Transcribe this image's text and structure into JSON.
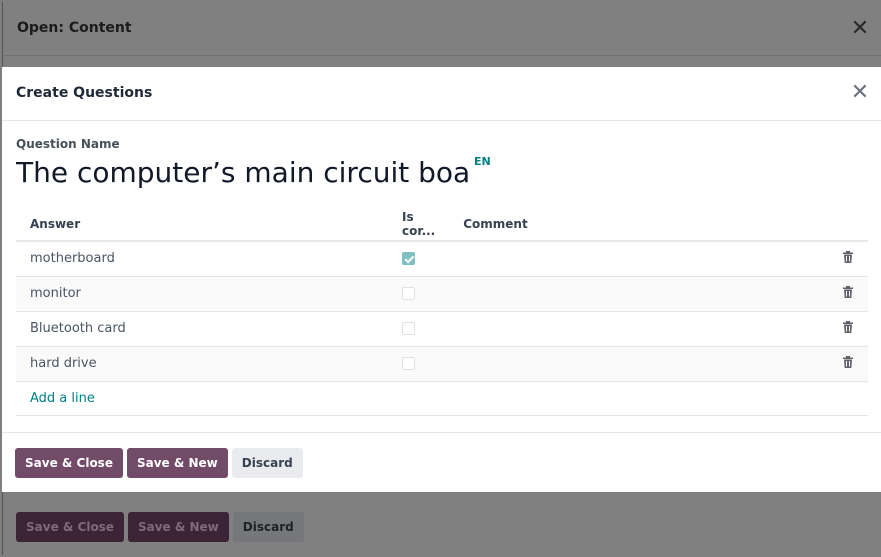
{
  "background_dialog": {
    "title": "Open: Content",
    "close_icon": "close-icon",
    "buttons": {
      "save_close": "Save & Close",
      "save_new": "Save & New",
      "discard": "Discard"
    }
  },
  "modal": {
    "title": "Create Questions",
    "close_icon": "close-icon",
    "question_name_label": "Question Name",
    "question_name_value": "The computer’s main circuit board",
    "language_badge": "EN",
    "table": {
      "columns": [
        "Answer",
        "Is cor...",
        "Comment"
      ],
      "rows": [
        {
          "answer": "motherboard",
          "is_correct": true,
          "comment": ""
        },
        {
          "answer": "monitor",
          "is_correct": false,
          "comment": ""
        },
        {
          "answer": "Bluetooth card",
          "is_correct": false,
          "comment": ""
        },
        {
          "answer": "hard drive",
          "is_correct": false,
          "comment": ""
        }
      ],
      "add_line_label": "Add a line",
      "delete_icon": "trash-icon"
    },
    "buttons": {
      "save_close": "Save & Close",
      "save_new": "Save & New",
      "discard": "Discard"
    }
  },
  "colors": {
    "primary": "#714b67",
    "link": "#017e84",
    "checkbox_checked": "#7fc0c3"
  }
}
